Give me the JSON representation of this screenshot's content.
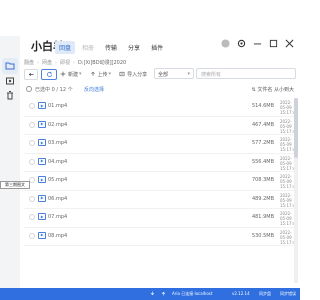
{
  "app": {
    "title": "小白羊"
  },
  "nav": {
    "items": [
      "回盘",
      "相册",
      "传输",
      "分享",
      "插件"
    ]
  },
  "breadcrumb": [
    "翻盘",
    "网盘",
    "即视",
    "D:[Xi]BD动漫][2020"
  ],
  "toolbar": {
    "new_label": "新建",
    "upload_label": "上传",
    "import_label": "导入分享",
    "scope_value": "全部",
    "search_placeholder": "搜索所有"
  },
  "status": {
    "selected_text": "已选中 0 / 12 个",
    "reverse_label": "反向选择",
    "sort_label": "文件名 从小到大"
  },
  "files": [
    {
      "name": "01.mp4",
      "size": "514.6MB",
      "date": "2022-05-09",
      "time": "15:17:43"
    },
    {
      "name": "02.mp4",
      "size": "467.4MB",
      "date": "2022-05-09",
      "time": "15:17:43"
    },
    {
      "name": "03.mp4",
      "size": "577.2MB",
      "date": "2022-05-09",
      "time": "15:17:43"
    },
    {
      "name": "04.mp4",
      "size": "556.4MB",
      "date": "2022-05-09",
      "time": "15:17:43"
    },
    {
      "name": "05.mp4",
      "size": "708.3MB",
      "date": "2022-05-09",
      "time": "15:17:43"
    },
    {
      "name": "06.mp4",
      "size": "489.2MB",
      "date": "2022-05-09",
      "time": "15:17:43"
    },
    {
      "name": "07.mp4",
      "size": "481.9MB",
      "date": "2022-05-09",
      "time": "15:17:43"
    },
    {
      "name": "08.mp4",
      "size": "530.5MB",
      "date": "2022-05-09",
      "time": "15:17:43"
    }
  ],
  "tooltip": "第三期图文",
  "footer": {
    "server": "Aria 已连接 localhost",
    "version": "v2.12.14",
    "sync": "同步盘",
    "sync_status": "同步错误"
  },
  "colors": {
    "accent": "#2f6fdf",
    "link": "#3b78d8"
  }
}
